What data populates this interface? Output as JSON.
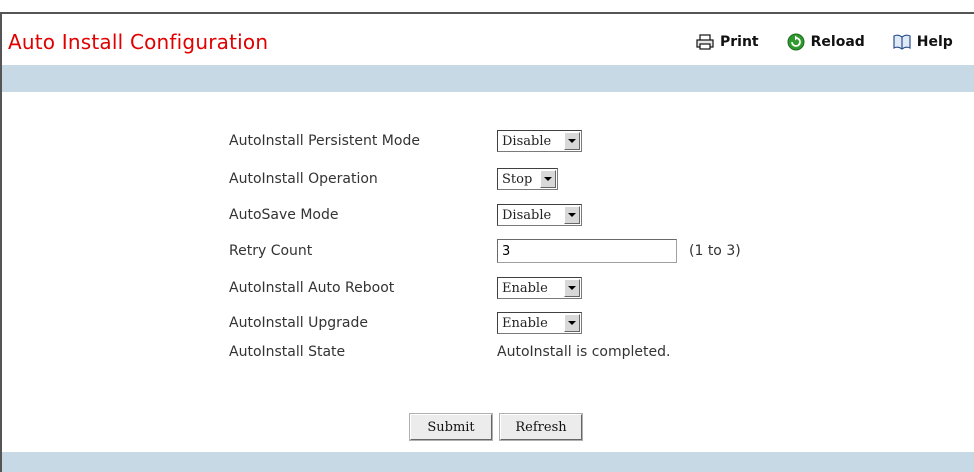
{
  "header": {
    "title": "Auto Install Configuration",
    "toolbar": {
      "print_label": "Print",
      "reload_label": "Reload",
      "help_label": "Help"
    }
  },
  "form": {
    "persistent_mode": {
      "label": "AutoInstall Persistent Mode",
      "value": "Disable"
    },
    "operation": {
      "label": "AutoInstall Operation",
      "value": "Stop"
    },
    "autosave_mode": {
      "label": "AutoSave Mode",
      "value": "Disable"
    },
    "retry_count": {
      "label": "Retry Count",
      "value": "3",
      "hint": "(1 to 3)"
    },
    "auto_reboot": {
      "label": "AutoInstall Auto Reboot",
      "value": "Enable"
    },
    "upgrade": {
      "label": "AutoInstall Upgrade",
      "value": "Enable"
    },
    "state": {
      "label": "AutoInstall State",
      "value": "AutoInstall is completed."
    }
  },
  "buttons": {
    "submit_label": "Submit",
    "refresh_label": "Refresh"
  },
  "colors": {
    "title": "#e00000",
    "band": "#c8d9e6"
  }
}
